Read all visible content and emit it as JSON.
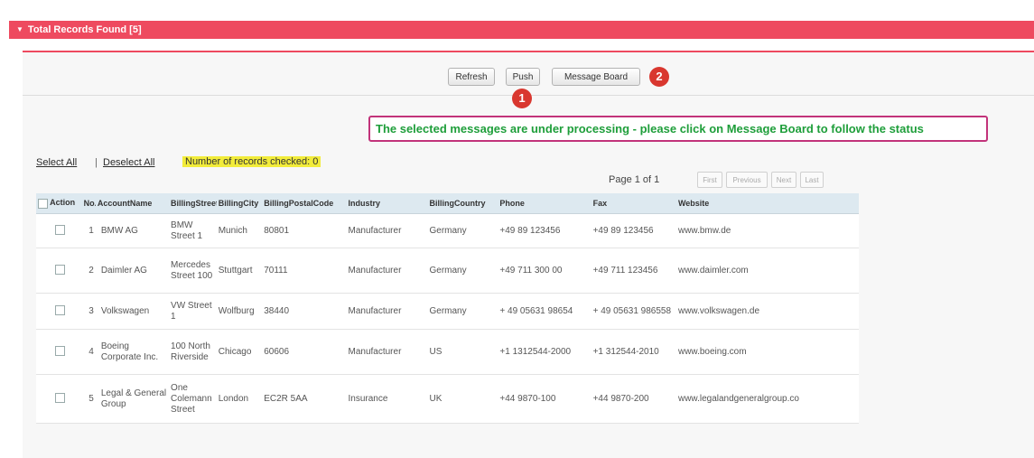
{
  "header": {
    "title": "Total Records Found [5]"
  },
  "toolbar": {
    "refresh_label": "Refresh",
    "push_label": "Push",
    "message_board_label": "Message Board"
  },
  "markers": {
    "one": "1",
    "two": "2"
  },
  "status_message": "The selected messages are under processing - please click on Message Board to follow the status",
  "selection": {
    "select_all": "Select All",
    "separator": "|",
    "deselect_all": "Deselect All",
    "checked_text": "Number of records checked: 0"
  },
  "pagination": {
    "page_text": "Page 1  of  1",
    "first": "First",
    "previous": "Previous",
    "next": "Next",
    "last": "Last"
  },
  "table": {
    "columns": [
      "Action",
      "No.",
      "AccountName",
      "BillingStreet",
      "BillingCity",
      "BillingPostalCode",
      "Industry",
      "BillingCountry",
      "Phone",
      "Fax",
      "Website"
    ],
    "rows": [
      {
        "no": "1",
        "account": "BMW AG",
        "street": "BMW Street 1",
        "city": "Munich",
        "postal": "80801",
        "industry": "Manufacturer",
        "country": "Germany",
        "phone": "+49 89 123456",
        "fax": "+49 89 123456",
        "website": "www.bmw.de"
      },
      {
        "no": "2",
        "account": "Daimler AG",
        "street": "Mercedes Street 100",
        "city": "Stuttgart",
        "postal": "70111",
        "industry": "Manufacturer",
        "country": "Germany",
        "phone": "+49 711 300 00",
        "fax": "+49 711 123456",
        "website": "www.daimler.com"
      },
      {
        "no": "3",
        "account": "Volkswagen",
        "street": "VW Street 1",
        "city": "Wolfburg",
        "postal": "38440",
        "industry": "Manufacturer",
        "country": "Germany",
        "phone": "+ 49 05631 98654",
        "fax": "+ 49 05631 986558",
        "website": "www.volkswagen.de"
      },
      {
        "no": "4",
        "account": "Boeing Corporate Inc.",
        "street": "100 North Riverside",
        "city": "Chicago",
        "postal": "60606",
        "industry": "Manufacturer",
        "country": "US",
        "phone": "+1 1312544-2000",
        "fax": "+1 312544-2010",
        "website": "www.boeing.com"
      },
      {
        "no": "5",
        "account": "Legal & General Group",
        "street": "One Colemann Street",
        "city": "London",
        "postal": "EC2R 5AA",
        "industry": "Insurance",
        "country": "UK",
        "phone": "+44 9870-100",
        "fax": "+44 9870-200",
        "website": "www.legalandgeneralgroup.co"
      }
    ]
  },
  "colors": {
    "header_bg": "#ee4a5f",
    "marker": "#d9372f",
    "message_border": "#c2337a",
    "message_text": "#1e9e3a",
    "highlight": "#f2ec3a"
  }
}
